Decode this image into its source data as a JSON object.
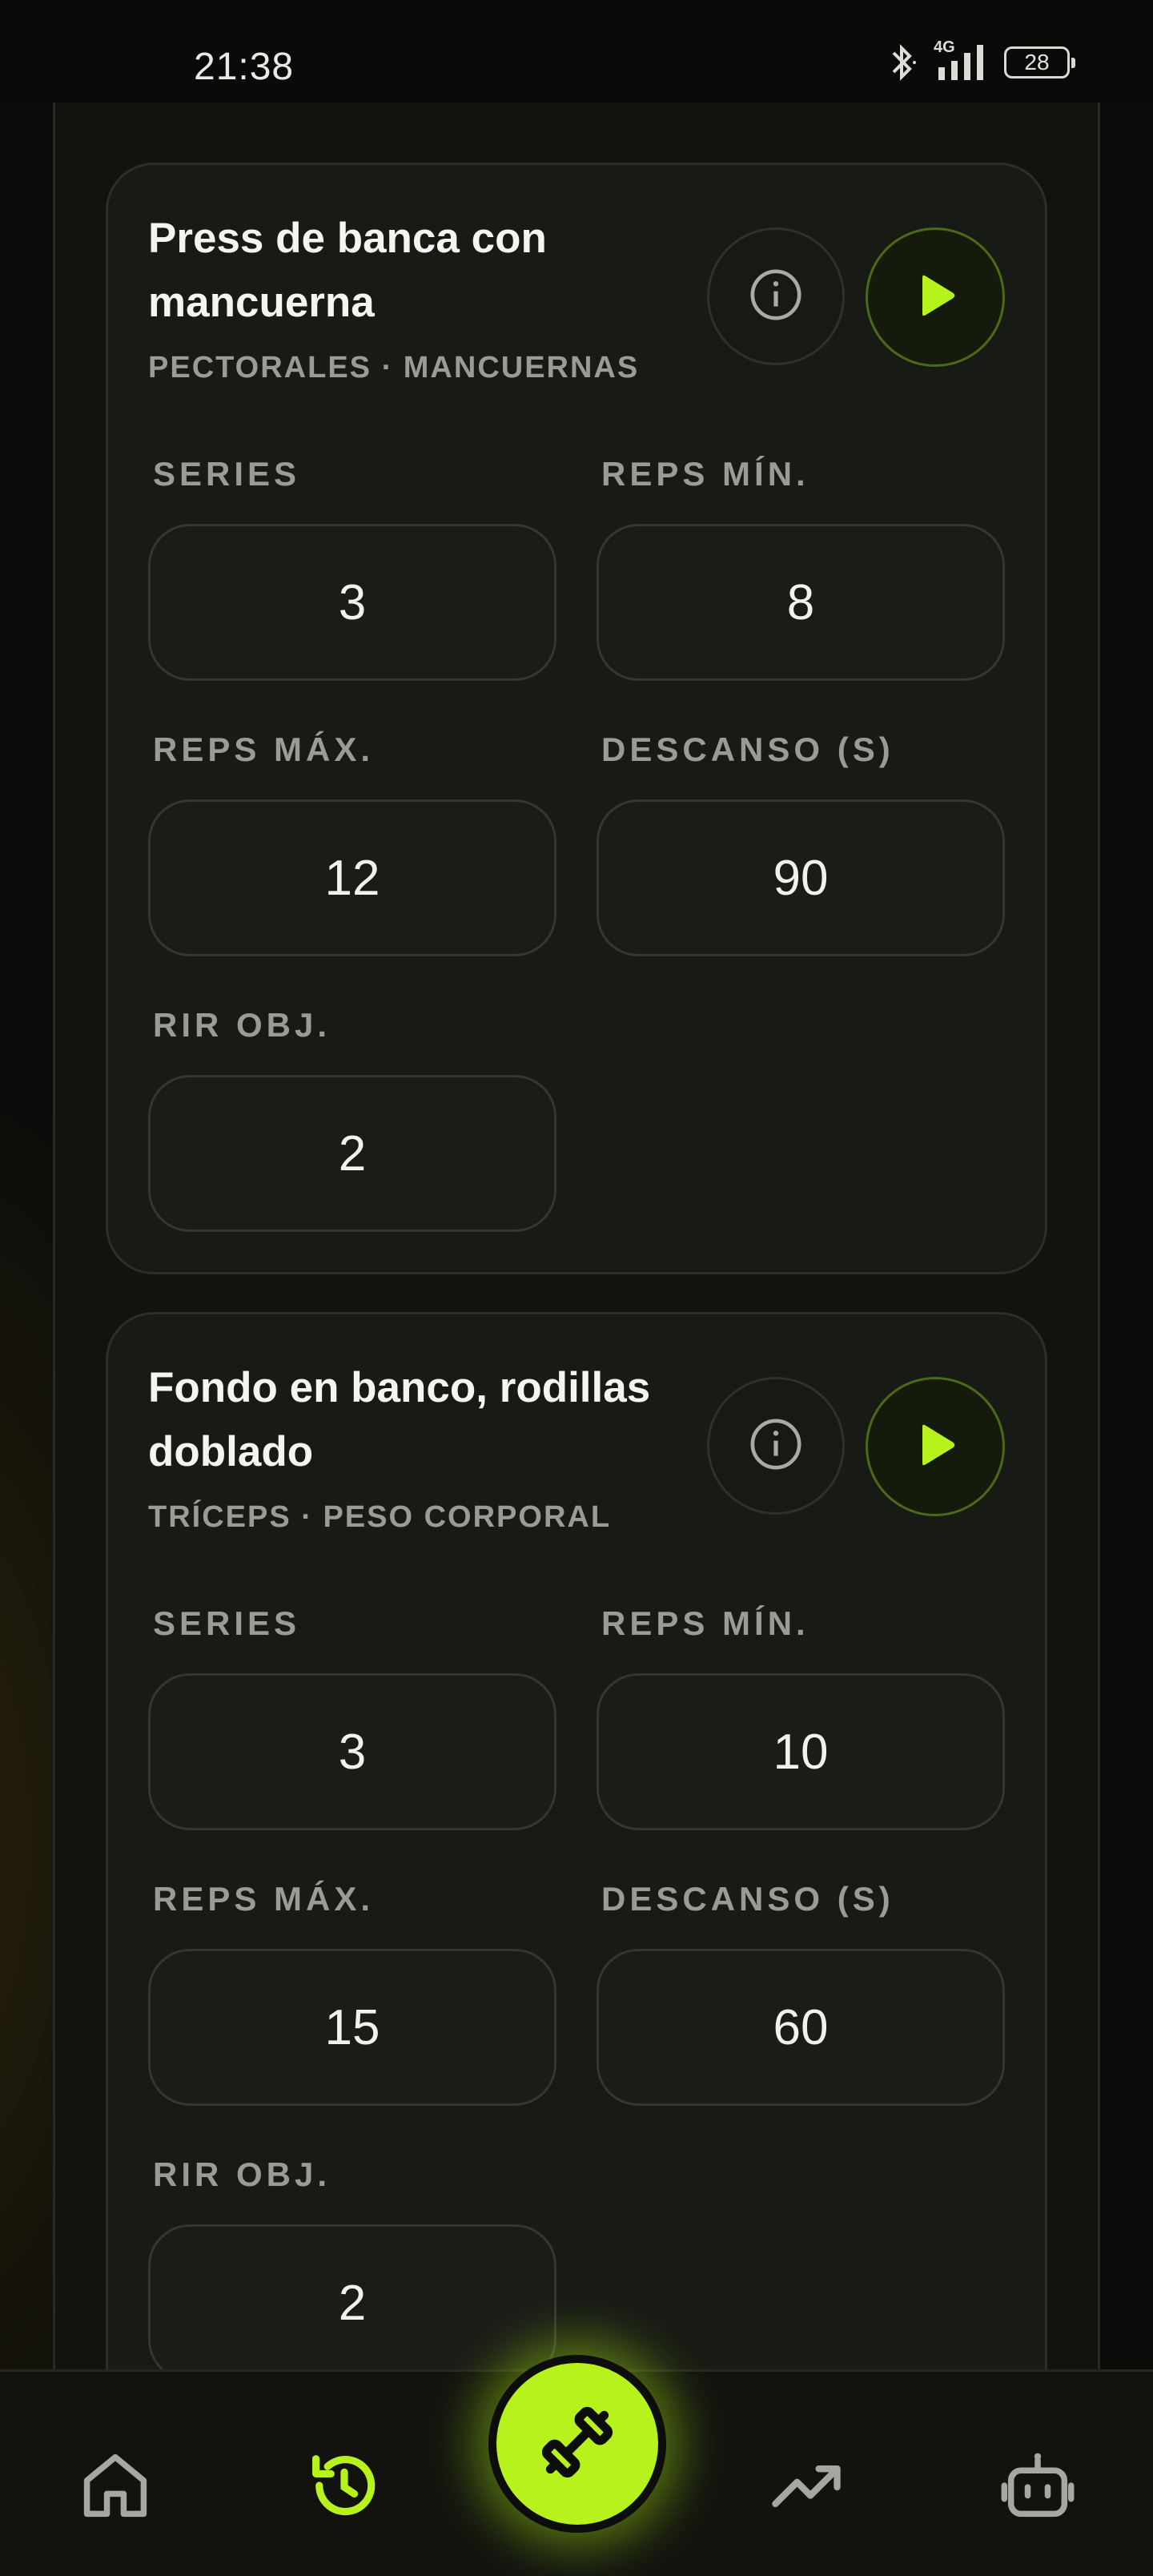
{
  "status_bar": {
    "time": "21:38",
    "network": "4G",
    "battery": "28"
  },
  "exercises": [
    {
      "title": "Press de banca con mancuerna",
      "subtitle": "PECTORALES · MANCUERNAS",
      "fields": {
        "series": {
          "label": "SERIES",
          "value": "3"
        },
        "reps_min": {
          "label": "REPS MÍN.",
          "value": "8"
        },
        "reps_max": {
          "label": "REPS MÁX.",
          "value": "12"
        },
        "rest": {
          "label": "DESCANSO (S)",
          "value": "90"
        },
        "rir": {
          "label": "RIR OBJ.",
          "value": "2"
        }
      }
    },
    {
      "title": "Fondo en banco, rodillas doblado",
      "subtitle": "TRÍCEPS · PESO CORPORAL",
      "fields": {
        "series": {
          "label": "SERIES",
          "value": "3"
        },
        "reps_min": {
          "label": "REPS MÍN.",
          "value": "10"
        },
        "reps_max": {
          "label": "REPS MÁX.",
          "value": "15"
        },
        "rest": {
          "label": "DESCANSO (S)",
          "value": "60"
        },
        "rir": {
          "label": "RIR OBJ.",
          "value": "2"
        }
      }
    }
  ],
  "icons": {
    "info": "info-icon",
    "play": "play-icon",
    "home": "home-icon",
    "history": "history-icon",
    "workout": "dumbbell-icon",
    "progress": "trending-up-icon",
    "assistant": "robot-icon"
  },
  "colors": {
    "accent": "#b8f21c",
    "background": "#0b0c0a",
    "card": "#181a15",
    "muted_text": "#9a9b94"
  },
  "bottom_nav": {
    "active": "history"
  }
}
